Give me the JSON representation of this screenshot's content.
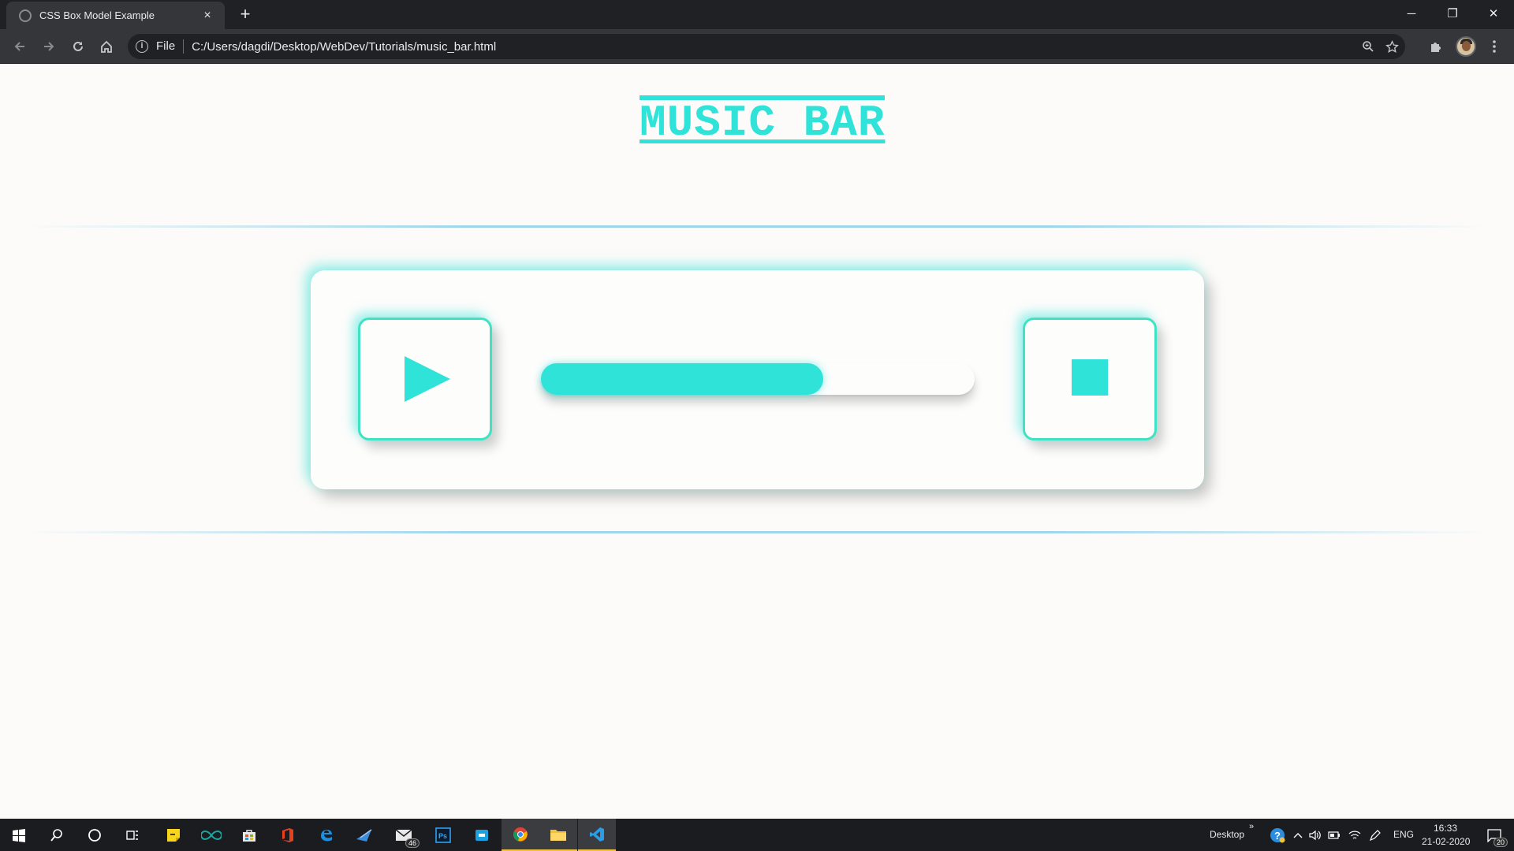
{
  "browser": {
    "tab_title": "CSS Box Model Example",
    "tab_close": "×",
    "new_tab": "+",
    "scheme_label": "File",
    "url": "C:/Users/dagdi/Desktop/WebDev/Tutorials/music_bar.html",
    "window_controls": {
      "minimize": "─",
      "restore": "❐",
      "close": "✕"
    }
  },
  "page": {
    "heading": "MUSIC BAR",
    "player": {
      "progress": 0.65,
      "accent_color": "#2fe3d9",
      "border_color": "#3fe3c3"
    }
  },
  "taskbar": {
    "mail_badge": "46",
    "desktop_label": "Desktop",
    "desktop_chevron": "»",
    "language": "ENG",
    "time": "16:33",
    "date": "21-02-2020",
    "notification_count": "20"
  }
}
